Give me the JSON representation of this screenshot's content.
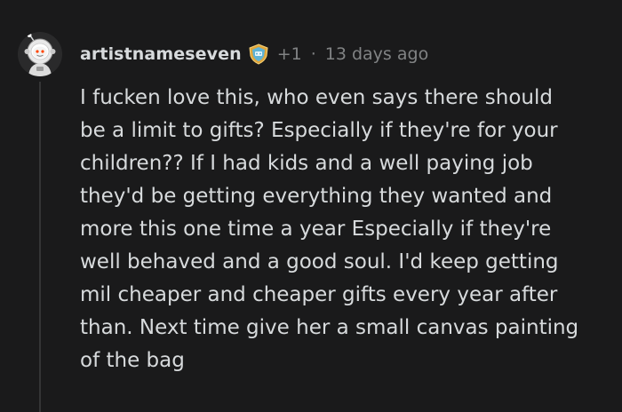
{
  "comment": {
    "username": "artistnameseven",
    "score": "+1",
    "separator": "·",
    "timestamp": "13 days ago",
    "body_lines": [
      "I fucken love this, who even says there should",
      "be a limit to gifts? Especially if they're for your",
      "children?? If I had kids and a well paying job",
      "they'd be getting everything they wanted and",
      "more this one time a year Especially if they're",
      "well behaved and a good soul. I'd keep getting",
      "mil cheaper and cheaper gifts every year after",
      "than. Next time give her a small canvas painting",
      "of the bag"
    ],
    "avatar_icon": "astronaut-snoo-avatar",
    "flair_icon": "shield-award-icon"
  },
  "colors": {
    "background": "#1a1a1b",
    "text": "#d7dadc",
    "meta": "#818384",
    "thread_line": "#343536"
  }
}
